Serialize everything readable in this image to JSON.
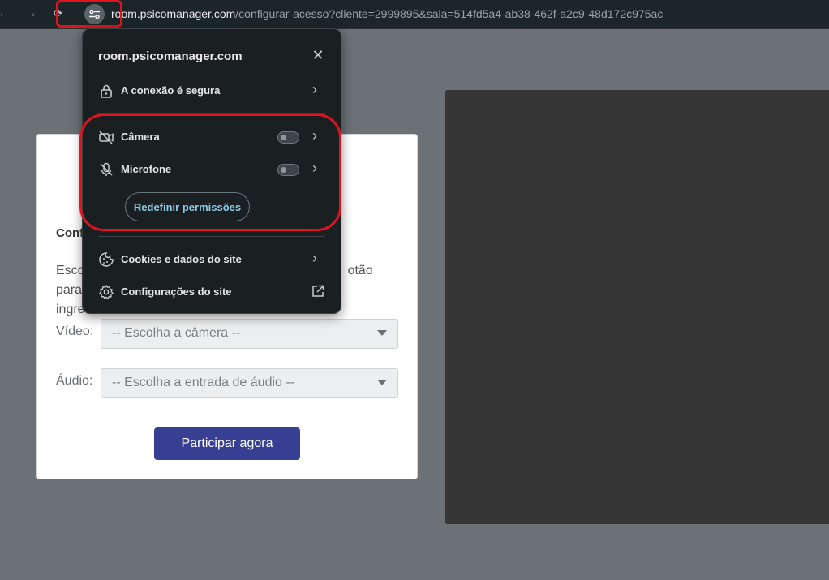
{
  "browser": {
    "url_host": "room.psicomanager.com",
    "url_path": "/configurar-acesso?cliente=2999895&sala=514fd5a4-ab38-462f-a2c9-48d172c975ac",
    "icons": {
      "back": "arrow-left-icon",
      "forward": "arrow-right-icon",
      "reload": "reload-icon",
      "site_info": "tune-icon"
    }
  },
  "site_popup": {
    "host": "room.psicomanager.com",
    "close_icon": "close-icon",
    "connection": {
      "label": "A conexão é segura",
      "icon": "lock-icon"
    },
    "camera": {
      "label": "Câmera",
      "icon": "camera-off-icon",
      "enabled": false
    },
    "microphone": {
      "label": "Microfone",
      "icon": "mic-off-icon",
      "enabled": false
    },
    "reset_label": "Redefinir permissões",
    "cookies": {
      "label": "Cookies e dados do site",
      "icon": "cookie-icon"
    },
    "site_settings": {
      "label": "Configurações do site",
      "icon": "gear-icon"
    }
  },
  "page": {
    "title_partial": "Conf",
    "desc_left_line1": "Esco",
    "desc_right_line1": "otão para",
    "desc_left_line2": "ingre",
    "video_label": "Vídeo:",
    "video_placeholder": "-- Escolha a câmera --",
    "audio_label": "Áudio:",
    "audio_placeholder": "-- Escolha a entrada de áudio --",
    "join_label": "Participar agora"
  },
  "colors": {
    "page_background": "#6b7175",
    "toolbar": "#1c2528",
    "popup_background": "#1a1f22",
    "accent_link": "#8ecbe9",
    "join_button": "#363f91",
    "annotation_red": "#e0141e",
    "video_panel": "#363636"
  }
}
